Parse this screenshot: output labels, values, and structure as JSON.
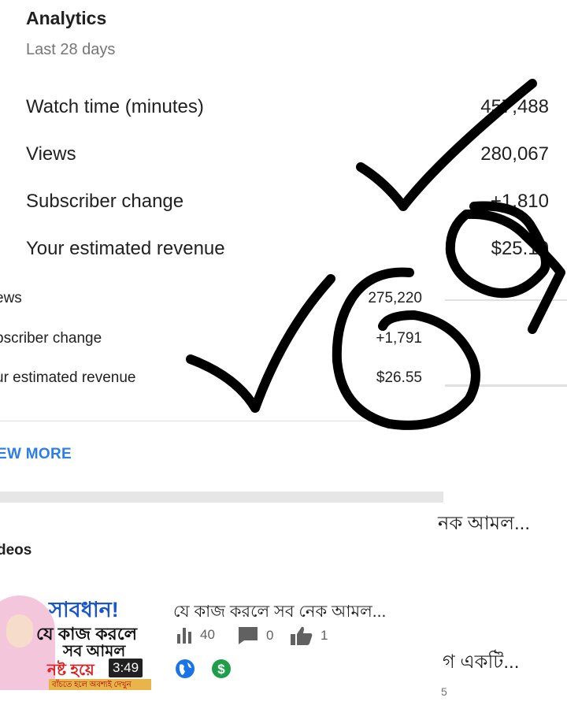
{
  "analytics": {
    "title": "Analytics",
    "period": "Last 28 days",
    "rows": [
      {
        "label": "Watch time (minutes)",
        "value": "457,488"
      },
      {
        "label": "Views",
        "value": "280,067"
      },
      {
        "label": "Subscriber change",
        "value": "+1,810"
      },
      {
        "label": "Your estimated revenue",
        "value": "$25.10"
      }
    ]
  },
  "lower": {
    "rows": [
      {
        "label": "ews",
        "value": "275,220"
      },
      {
        "label": "bscriber change",
        "value": "+1,791"
      },
      {
        "label": "ur estimated revenue",
        "value": "$26.55"
      }
    ],
    "view_more": "EW MORE",
    "peek_title_1": "নক আমল...",
    "videos_heading": "deos",
    "video": {
      "thumb_line1": "সাবধান!",
      "thumb_line2": "যে কাজ করলে",
      "thumb_line3": "সব আমল",
      "thumb_line4": "নষ্ট হয়ে",
      "thumb_banner": "বাঁচতে হলে অবশ্যই দেখুন",
      "duration": "3:49",
      "title": "যে কাজ করলে সব নেক আমল...",
      "views": "40",
      "comments": "0",
      "likes": "1"
    },
    "peek_title_2": "গ একটি...",
    "peek_sub": "5"
  },
  "colors": {
    "accent": "#2b7de9",
    "ink": "#000000",
    "monetized": "#1e9e4a",
    "public": "#1a73e8"
  }
}
